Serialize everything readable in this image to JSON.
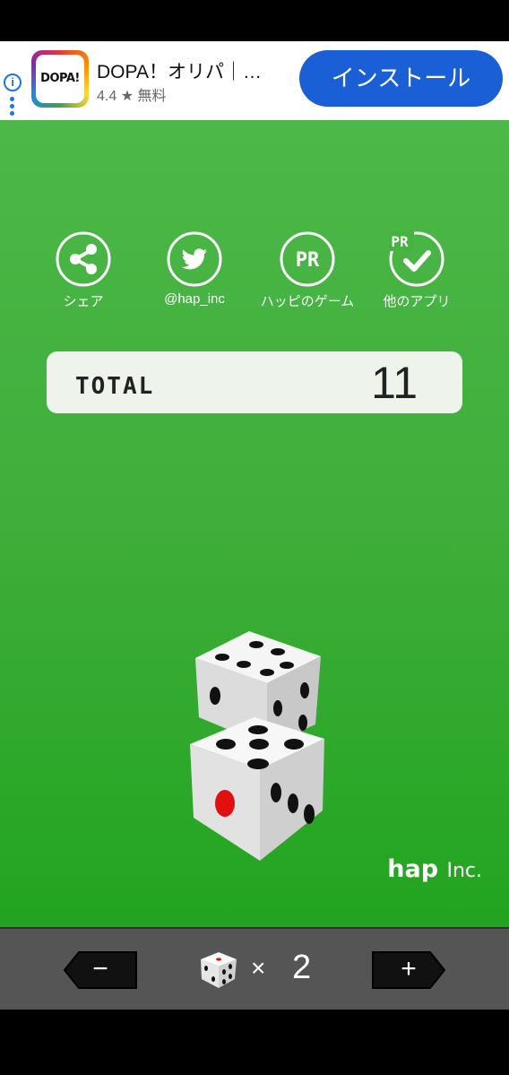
{
  "ad": {
    "logo_text": "DOPA!",
    "title": "DOPA！オリパ｜…",
    "rating": "4.4",
    "star": "★",
    "price": "無料",
    "install_label": "インストール",
    "info_glyph": "i"
  },
  "menu": [
    {
      "label": "シェア",
      "icon": "share-icon"
    },
    {
      "label": "@hap_inc",
      "icon": "twitter-icon"
    },
    {
      "label": "ハッピのゲーム",
      "icon": "pr-icon"
    },
    {
      "label": "他のアプリ",
      "icon": "pr-check-icon"
    }
  ],
  "pr_text": "PR",
  "total": {
    "label": "TOTAL",
    "value": "11"
  },
  "dice_faces": [
    5,
    6
  ],
  "brand": {
    "main": "hap",
    "suffix": "Inc."
  },
  "controls": {
    "minus": "−",
    "plus": "+",
    "times": "×",
    "count": "2"
  },
  "colors": {
    "bg_green": "#3fae3a",
    "ad_button": "#1a5fd6",
    "bottom_bar": "#555555"
  }
}
